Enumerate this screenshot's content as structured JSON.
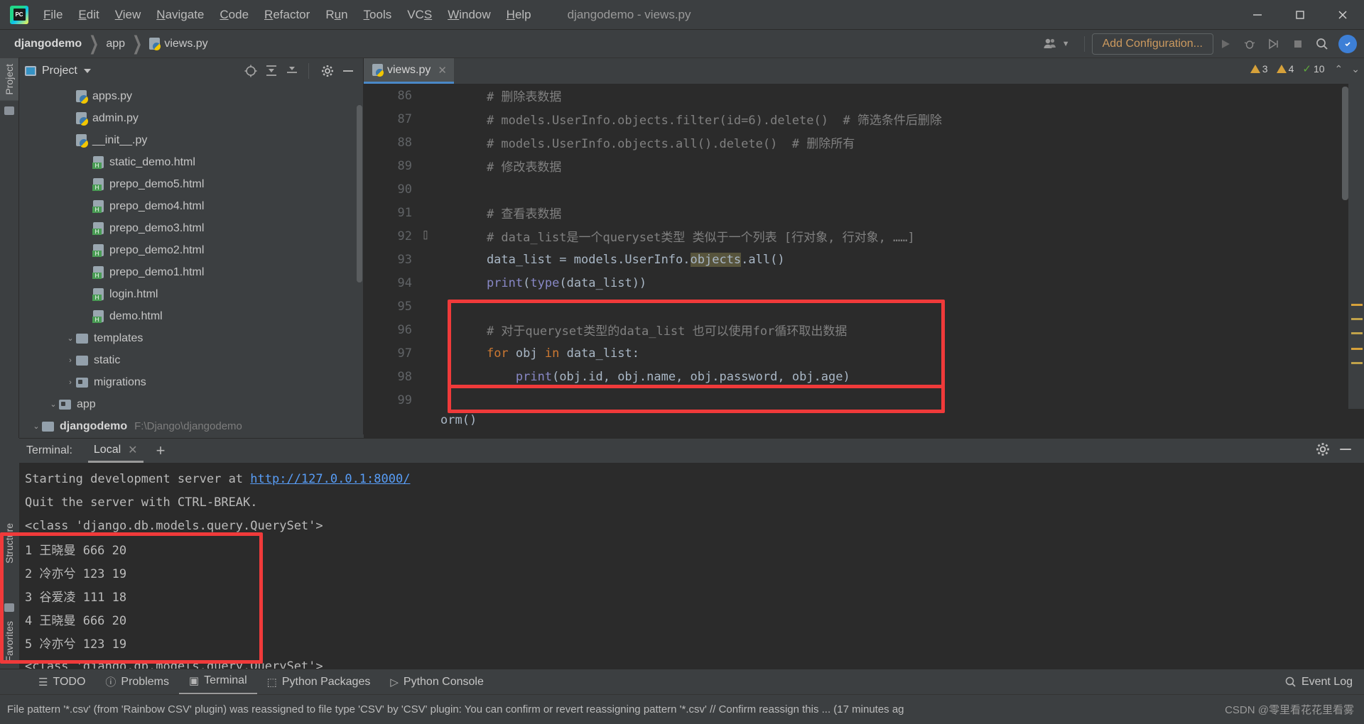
{
  "window": {
    "title": "djangodemo - views.py",
    "logo_text": "PC",
    "minimize": "—",
    "maximize": "❐",
    "close": "✕"
  },
  "menu": [
    {
      "label": "File",
      "mnemonic": "F"
    },
    {
      "label": "Edit",
      "mnemonic": "E"
    },
    {
      "label": "View",
      "mnemonic": "V"
    },
    {
      "label": "Navigate",
      "mnemonic": "N"
    },
    {
      "label": "Code",
      "mnemonic": "C"
    },
    {
      "label": "Refactor",
      "mnemonic": "R"
    },
    {
      "label": "Run",
      "mnemonic": "u"
    },
    {
      "label": "Tools",
      "mnemonic": "T"
    },
    {
      "label": "VCS",
      "mnemonic": "S"
    },
    {
      "label": "Window",
      "mnemonic": "W"
    },
    {
      "label": "Help",
      "mnemonic": "H"
    }
  ],
  "navbar": {
    "breadcrumbs": [
      "djangodemo",
      "app",
      "views.py"
    ],
    "add_configuration": "Add Configuration...",
    "sep": "❯"
  },
  "left_strip": {
    "project_tab": "Project"
  },
  "project_panel": {
    "title": "Project",
    "tree": [
      {
        "depth": 0,
        "arrow": "v",
        "icon": "folder",
        "label": "djangodemo",
        "bold": true,
        "path": "F:\\Django\\djangodemo"
      },
      {
        "depth": 1,
        "arrow": "v",
        "icon": "folder-src",
        "label": "app",
        "bold": false,
        "path": ""
      },
      {
        "depth": 2,
        "arrow": ">",
        "icon": "folder-src",
        "label": "migrations",
        "bold": false,
        "path": ""
      },
      {
        "depth": 2,
        "arrow": ">",
        "icon": "folder",
        "label": "static",
        "bold": false,
        "path": ""
      },
      {
        "depth": 2,
        "arrow": "v",
        "icon": "folder",
        "label": "templates",
        "bold": false,
        "path": ""
      },
      {
        "depth": 3,
        "arrow": "",
        "icon": "html",
        "label": "demo.html",
        "bold": false,
        "path": ""
      },
      {
        "depth": 3,
        "arrow": "",
        "icon": "html",
        "label": "login.html",
        "bold": false,
        "path": ""
      },
      {
        "depth": 3,
        "arrow": "",
        "icon": "html",
        "label": "prepo_demo1.html",
        "bold": false,
        "path": ""
      },
      {
        "depth": 3,
        "arrow": "",
        "icon": "html",
        "label": "prepo_demo2.html",
        "bold": false,
        "path": ""
      },
      {
        "depth": 3,
        "arrow": "",
        "icon": "html",
        "label": "prepo_demo3.html",
        "bold": false,
        "path": ""
      },
      {
        "depth": 3,
        "arrow": "",
        "icon": "html",
        "label": "prepo_demo4.html",
        "bold": false,
        "path": ""
      },
      {
        "depth": 3,
        "arrow": "",
        "icon": "html",
        "label": "prepo_demo5.html",
        "bold": false,
        "path": ""
      },
      {
        "depth": 3,
        "arrow": "",
        "icon": "html",
        "label": "static_demo.html",
        "bold": false,
        "path": ""
      },
      {
        "depth": 2,
        "arrow": "",
        "icon": "py",
        "label": "__init__.py",
        "bold": false,
        "path": ""
      },
      {
        "depth": 2,
        "arrow": "",
        "icon": "py",
        "label": "admin.py",
        "bold": false,
        "path": ""
      },
      {
        "depth": 2,
        "arrow": "",
        "icon": "py",
        "label": "apps.py",
        "bold": false,
        "path": ""
      }
    ]
  },
  "editor": {
    "tab_label": "views.py",
    "tab_close": "✕",
    "bottom_text": "orm()",
    "inspections": {
      "warnings": "3",
      "weak_warnings": "4",
      "typos": "10",
      "up_arrow": "⌃",
      "down_arrow": "⌄"
    },
    "lines": [
      {
        "no": "86",
        "fold": "",
        "segments": [
          {
            "t": "    # 删除表数据",
            "c": "cmt"
          }
        ]
      },
      {
        "no": "87",
        "fold": "",
        "segments": [
          {
            "t": "    # models.UserInfo.objects.filter(id=6).delete()  # 筛选条件后删除",
            "c": "cmt"
          }
        ]
      },
      {
        "no": "88",
        "fold": "",
        "segments": [
          {
            "t": "    # models.UserInfo.objects.all().delete()  # 删除所有",
            "c": "cmt"
          }
        ]
      },
      {
        "no": "89",
        "fold": "",
        "segments": [
          {
            "t": "    # 修改表数据",
            "c": "cmt"
          }
        ]
      },
      {
        "no": "90",
        "fold": "",
        "segments": [
          {
            "t": "",
            "c": "var"
          }
        ]
      },
      {
        "no": "91",
        "fold": "",
        "segments": [
          {
            "t": "    # 查看表数据",
            "c": "cmt"
          }
        ]
      },
      {
        "no": "92",
        "fold": "fold",
        "segments": [
          {
            "t": "    # data_list是一个queryset类型 类似于一个列表 [行对象, 行对象, ……]",
            "c": "cmt"
          }
        ]
      },
      {
        "no": "93",
        "fold": "",
        "segments": [
          {
            "t": "    data_list = models.UserInfo.",
            "c": "var"
          },
          {
            "t": "objects",
            "c": "hl"
          },
          {
            "t": ".all()",
            "c": "var"
          }
        ]
      },
      {
        "no": "94",
        "fold": "",
        "segments": [
          {
            "t": "    ",
            "c": "var"
          },
          {
            "t": "print",
            "c": "fn"
          },
          {
            "t": "(",
            "c": "var"
          },
          {
            "t": "type",
            "c": "fn"
          },
          {
            "t": "(data_list))",
            "c": "var"
          }
        ]
      },
      {
        "no": "95",
        "fold": "",
        "segments": [
          {
            "t": "",
            "c": "var"
          }
        ]
      },
      {
        "no": "96",
        "fold": "",
        "segments": [
          {
            "t": "    # 对于queryset类型的data_list 也可以使用for循环取出数据",
            "c": "cmt"
          }
        ]
      },
      {
        "no": "97",
        "fold": "",
        "segments": [
          {
            "t": "    ",
            "c": "var"
          },
          {
            "t": "for",
            "c": "kw"
          },
          {
            "t": " obj ",
            "c": "var"
          },
          {
            "t": "in",
            "c": "kw"
          },
          {
            "t": " data_list:",
            "c": "var"
          }
        ]
      },
      {
        "no": "98",
        "fold": "",
        "segments": [
          {
            "t": "        ",
            "c": "var"
          },
          {
            "t": "print",
            "c": "fn"
          },
          {
            "t": "(obj.id, obj.name, obj.password, obj.age)",
            "c": "var"
          }
        ]
      },
      {
        "no": "99",
        "fold": "",
        "segments": [
          {
            "t": "",
            "c": "var"
          }
        ]
      }
    ]
  },
  "terminal": {
    "label": "Terminal:",
    "tab": "Local",
    "tab_close": "✕",
    "add": "+",
    "settings_icon": "gear-icon",
    "minimize_icon": "minimize-icon",
    "lines": [
      {
        "parts": [
          {
            "t": "Starting development server at ",
            "c": ""
          },
          {
            "t": "http://127.0.0.1:8000/",
            "c": "link"
          }
        ]
      },
      {
        "parts": [
          {
            "t": "Quit the server with CTRL-BREAK.",
            "c": ""
          }
        ]
      },
      {
        "parts": [
          {
            "t": "<class 'django.db.models.query.QuerySet'>",
            "c": ""
          }
        ]
      },
      {
        "parts": [
          {
            "t": "1 王晓曼 666 20",
            "c": ""
          }
        ]
      },
      {
        "parts": [
          {
            "t": "2 冷亦兮 123 19",
            "c": ""
          }
        ]
      },
      {
        "parts": [
          {
            "t": "3 谷爱凌 111 18",
            "c": ""
          }
        ]
      },
      {
        "parts": [
          {
            "t": "4 王晓曼 666 20",
            "c": ""
          }
        ]
      },
      {
        "parts": [
          {
            "t": "5 冷亦兮 123 19",
            "c": ""
          }
        ]
      },
      {
        "parts": [
          {
            "t": "<class 'django.db.models.query.QuerySet'>",
            "c": ""
          }
        ]
      }
    ]
  },
  "vertical_tabs": {
    "structure": "Structure",
    "favorites": "Favorites"
  },
  "statusbar": {
    "items": [
      {
        "label": "TODO",
        "icon": "list-icon",
        "active": false
      },
      {
        "label": "Problems",
        "icon": "info-icon",
        "active": false
      },
      {
        "label": "Terminal",
        "icon": "terminal-icon",
        "active": true
      },
      {
        "label": "Python Packages",
        "icon": "package-icon",
        "active": false
      },
      {
        "label": "Python Console",
        "icon": "console-icon",
        "active": false
      }
    ],
    "event_log": "Event Log"
  },
  "message_bar": {
    "text": "File pattern '*.csv' (from 'Rainbow CSV' plugin) was reassigned to file type 'CSV' by 'CSV' plugin: You can confirm or revert reassigning pattern '*.csv' // Confirm reassign this ... (17 minutes ag",
    "watermark": "CSDN @零里看花花里看雾"
  },
  "colors": {
    "accent_blue": "#4a88c7",
    "red_highlight": "#f03a3a",
    "editor_bg": "#2b2b2b",
    "panel_bg": "#3c3f41",
    "orange": "#cc7832"
  }
}
